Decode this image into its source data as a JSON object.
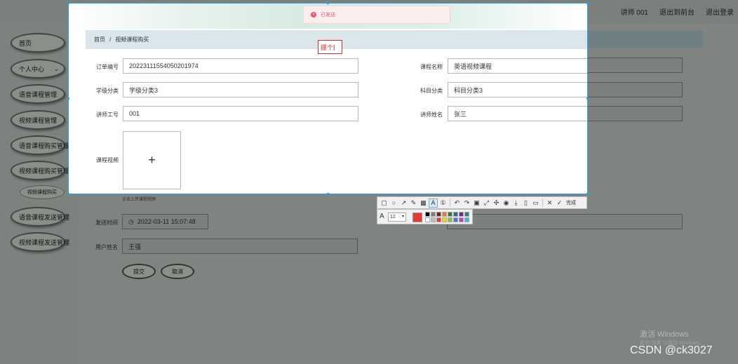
{
  "header": {
    "user_label": "讲师 001",
    "backend_label": "退出到前台",
    "logout_label": "退出登录"
  },
  "sidebar": {
    "items": [
      {
        "label": "首页"
      },
      {
        "label": "个人中心"
      },
      {
        "label": "语音课程管理"
      },
      {
        "label": "视频课程管理"
      },
      {
        "label": "语音课程购买管理"
      },
      {
        "label": "视频课程购买管理"
      },
      {
        "label": "视频课程购买"
      },
      {
        "label": "语音课程发送管理"
      },
      {
        "label": "视频课程发送管理"
      }
    ]
  },
  "breadcrumb": {
    "home": "首页",
    "separator": "/",
    "current": "视频课程购买"
  },
  "form": {
    "order_no": {
      "label": "订单编号",
      "value": "20223111554050201974"
    },
    "course_name": {
      "label": "课程名称",
      "value": "英语视频课程"
    },
    "grade": {
      "label": "学级分类",
      "value": "学级分类3"
    },
    "subject": {
      "label": "科目分类",
      "value": "科目分类3"
    },
    "teacher_id": {
      "label": "讲师工号",
      "value": "001"
    },
    "teacher_name": {
      "label": "讲师姓名",
      "value": "张三"
    },
    "video": {
      "label": "课程视频",
      "upload_glyph": "+",
      "hint": "点击上传课程视频"
    },
    "send_time": {
      "label": "发送时间",
      "value": "2022-03-11 15:07:48"
    },
    "user_name": {
      "label": "用户姓名",
      "value": "王强"
    },
    "submit_label": "提交",
    "cancel_label": "取消"
  },
  "toast": {
    "text": "已发送",
    "icon": "error-circle-icon"
  },
  "annotation": {
    "text": "挪个"
  },
  "toolbar": {
    "tools": [
      "rectangle-icon",
      "ellipse-icon",
      "arrow-icon",
      "pen-icon",
      "mosaic-icon",
      "text-icon",
      "sequence-icon",
      "undo-icon",
      "redo-icon",
      "ocr-icon",
      "fullscreen-icon",
      "pin-icon",
      "record-icon",
      "save-icon",
      "long-screenshot-icon",
      "translate-icon",
      "close-icon",
      "check-icon"
    ],
    "done_label": "完成",
    "font_size": "12",
    "current_color": "#e53935",
    "palette": [
      "#000000",
      "#7f7f7f",
      "#7f1d1d",
      "#e07b39",
      "#2e7d32",
      "#2a6a9a",
      "#6a2a8a",
      "#1a8a7a",
      "#ffffff",
      "#c0c0c0",
      "#e53935",
      "#f6d31c",
      "#8bc34a",
      "#3d7be0",
      "#c03fbf",
      "#3fb8d0"
    ]
  },
  "system": {
    "activate_title": "激活 Windows",
    "activate_sub": "转到\"设置\"以激活 Windows。",
    "watermark": "CSDN @ck3027"
  },
  "colors": {
    "accent_blue": "#27a0e8",
    "error_red": "#f0576a",
    "annotation_red": "#d92b2b"
  }
}
